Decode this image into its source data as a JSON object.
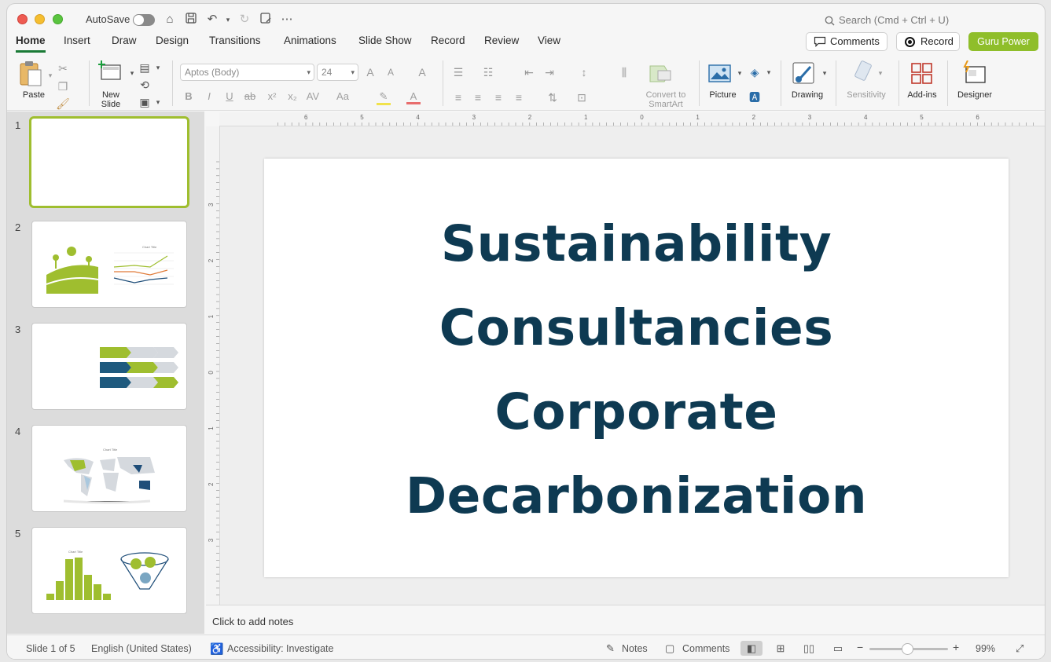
{
  "titlebar": {
    "autosave_label": "AutoSave",
    "search_placeholder": "Search (Cmd + Ctrl + U)"
  },
  "tabs": [
    "Home",
    "Insert",
    "Draw",
    "Design",
    "Transitions",
    "Animations",
    "Slide Show",
    "Record",
    "Review",
    "View"
  ],
  "actions": {
    "comments": "Comments",
    "record": "Record",
    "guru": "Guru Power",
    "guru_color": "#8fbe2a"
  },
  "ribbon": {
    "paste": "Paste",
    "new_slide": "New\nSlide",
    "font_name": "Aptos (Body)",
    "font_size": "24",
    "convert_smartart": "Convert to\nSmartArt",
    "picture": "Picture",
    "drawing": "Drawing",
    "sensitivity": "Sensitivity",
    "addins": "Add-ins",
    "designer": "Designer"
  },
  "thumbnails": [
    {
      "number": "1"
    },
    {
      "number": "2",
      "chart_title": "Chart Title"
    },
    {
      "number": "3"
    },
    {
      "number": "4",
      "chart_title": "Chart Title"
    },
    {
      "number": "5",
      "chart_title": "Chart Title"
    }
  ],
  "slide": {
    "title_lines": [
      "Sustainability",
      "Consultancies",
      "Corporate",
      "Decarbonization"
    ],
    "title_color": "#0e3a52"
  },
  "notes_placeholder": "Click to add notes",
  "status": {
    "slide_info": "Slide 1 of 5",
    "language": "English (United States)",
    "accessibility": "Accessibility: Investigate",
    "notes": "Notes",
    "comments": "Comments",
    "zoom": "99%"
  },
  "ruler": {
    "h": [
      "6",
      "5",
      "4",
      "3",
      "2",
      "1",
      "0",
      "1",
      "2",
      "3",
      "4",
      "5",
      "6"
    ],
    "v": [
      "3",
      "2",
      "1",
      "0",
      "1",
      "2",
      "3"
    ]
  }
}
